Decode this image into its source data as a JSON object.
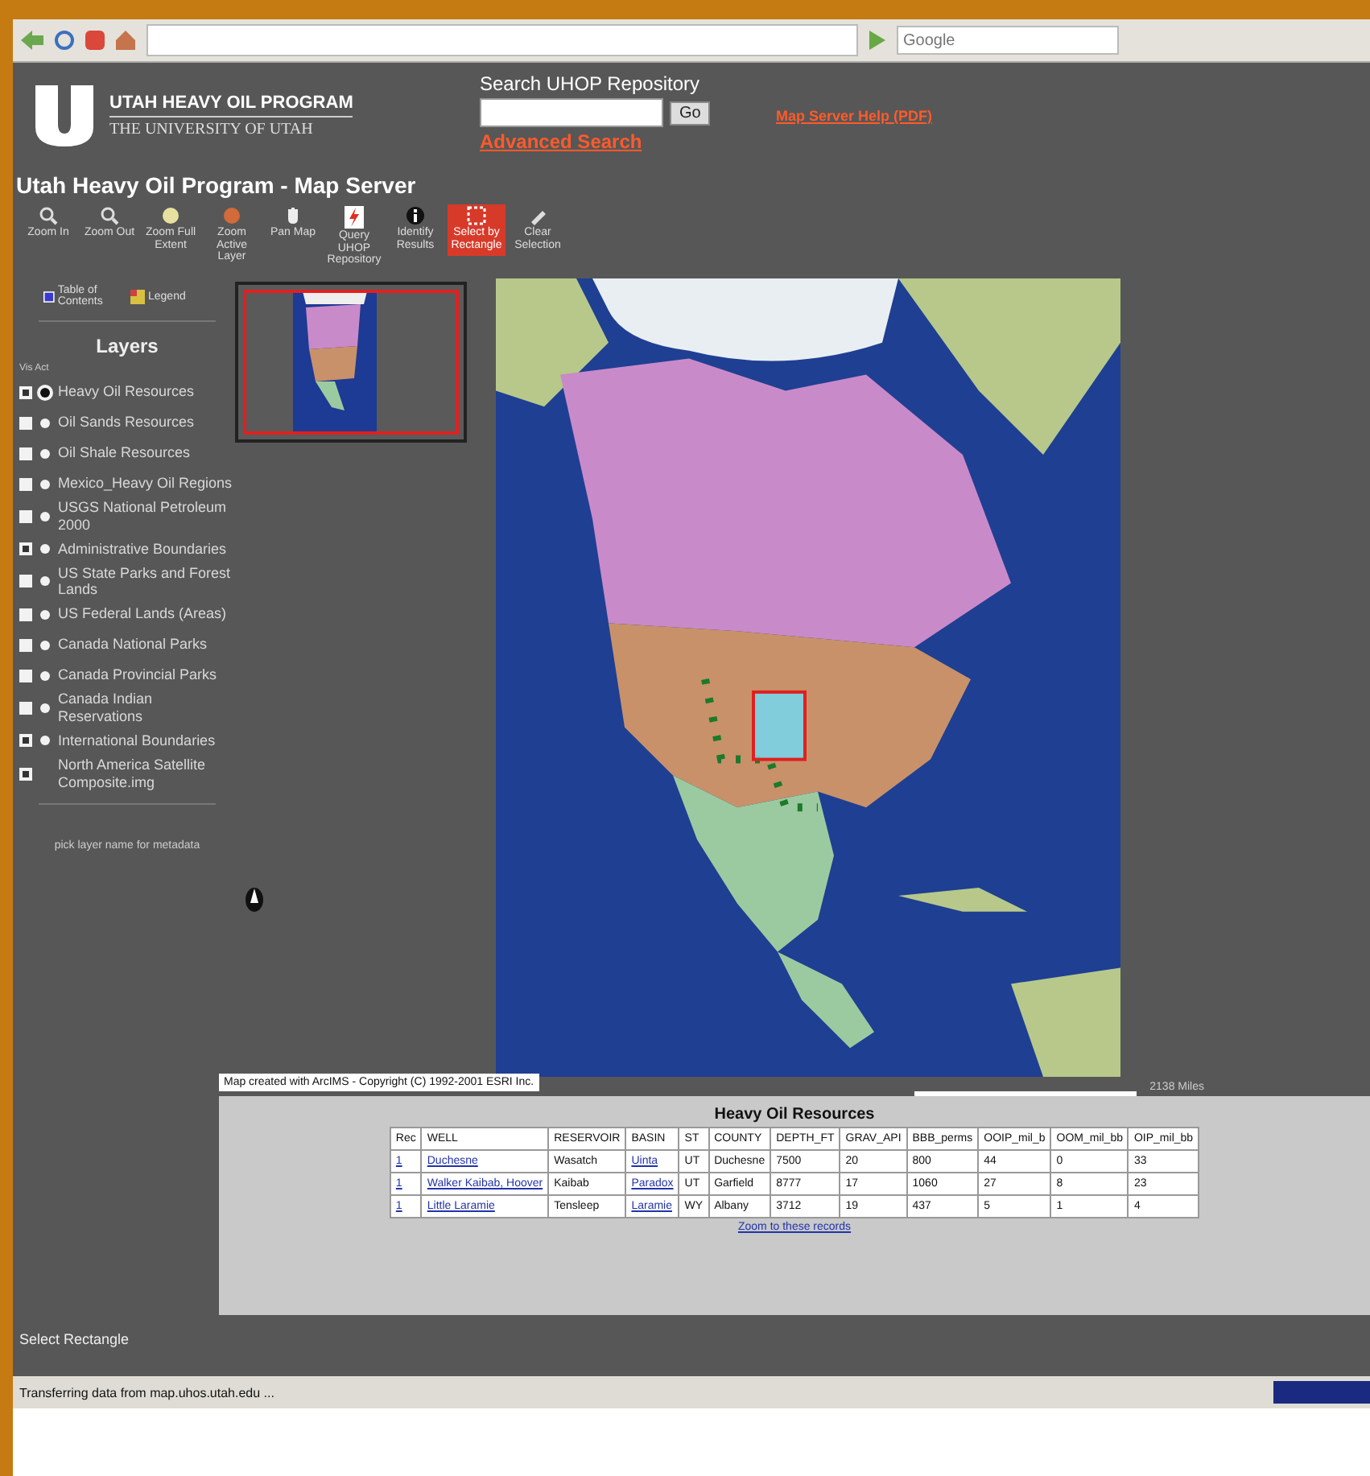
{
  "browser": {
    "search_placeholder": "Google"
  },
  "header": {
    "program": "UTAH HEAVY OIL PROGRAM",
    "university": "THE UNIVERSITY OF UTAH",
    "search_label": "Search UHOP Repository",
    "search_button": "Go",
    "advanced_link": "Advanced Search",
    "help_link": "Map Server Help (PDF)"
  },
  "title": "Utah Heavy Oil Program - Map Server",
  "tools": [
    {
      "kind": "zoom-in",
      "label": "Zoom In",
      "selected": false
    },
    {
      "kind": "zoom-out",
      "label": "Zoom Out",
      "selected": false
    },
    {
      "kind": "full-extent",
      "label": "Zoom Full Extent",
      "selected": false
    },
    {
      "kind": "active-layer",
      "label": "Zoom Active Layer",
      "selected": false
    },
    {
      "kind": "pan",
      "label": "Pan Map",
      "selected": false
    },
    {
      "kind": "query",
      "label": "Query UHOP Repository",
      "selected": false
    },
    {
      "kind": "identify",
      "label": "Identify Results",
      "selected": false
    },
    {
      "kind": "select",
      "label": "Select by Rectangle",
      "selected": true
    },
    {
      "kind": "clear",
      "label": "Clear Selection",
      "selected": false
    }
  ],
  "sidebar": {
    "toc": "Table of Contents",
    "legend": "Legend",
    "layers_title": "Layers",
    "columns": "Vis Act",
    "note": "pick layer name for metadata",
    "layers": [
      {
        "kind": "feature",
        "name": "Heavy Oil Resources",
        "visible": true,
        "active": true
      },
      {
        "kind": "feature",
        "name": "Oil Sands Resources",
        "visible": false,
        "active": false
      },
      {
        "kind": "feature",
        "name": "Oil Shale Resources",
        "visible": false,
        "active": false
      },
      {
        "kind": "feature",
        "name": "Mexico_Heavy Oil Regions",
        "visible": false,
        "active": false
      },
      {
        "kind": "feature",
        "name": "USGS National Petroleum 2000",
        "visible": false,
        "active": false
      },
      {
        "kind": "feature",
        "name": "Administrative Boundaries",
        "visible": true,
        "active": false
      },
      {
        "kind": "feature",
        "name": "US State Parks and Forest Lands",
        "visible": false,
        "active": false
      },
      {
        "kind": "feature",
        "name": "US Federal Lands (Areas)",
        "visible": false,
        "active": false
      },
      {
        "kind": "feature",
        "name": "Canada National Parks",
        "visible": false,
        "active": false
      },
      {
        "kind": "feature",
        "name": "Canada Provincial Parks",
        "visible": false,
        "active": false
      },
      {
        "kind": "feature",
        "name": "Canada Indian Reservations",
        "visible": false,
        "active": false
      },
      {
        "kind": "feature",
        "name": "International Boundaries",
        "visible": true,
        "active": false
      },
      {
        "name": "North America Satellite Composite.img",
        "visible": true
      }
    ]
  },
  "map": {
    "scale": "2138 Miles"
  },
  "results": {
    "copyright": "Map created with ArcIMS - Copyright (C) 1992-2001 ESRI Inc.",
    "title": "Heavy Oil Resources",
    "columns": [
      {
        "label": "Rec",
        "kind": "link"
      },
      {
        "label": "WELL",
        "kind": "link"
      },
      {
        "label": "RESERVOIR",
        "kind": "text"
      },
      {
        "label": "BASIN",
        "kind": "link"
      },
      {
        "label": "ST",
        "kind": "text"
      },
      {
        "label": "COUNTY",
        "kind": "text"
      },
      {
        "label": "DEPTH_FT",
        "kind": "text"
      },
      {
        "label": "GRAV_API",
        "kind": "text"
      },
      {
        "label": "BBB_perms",
        "kind": "text"
      },
      {
        "label": "OOIP_mil_b",
        "kind": "text"
      },
      {
        "label": "OOM_mil_bb",
        "kind": "text"
      },
      {
        "label": "OIP_mil_bb",
        "kind": "text"
      }
    ],
    "rows": [
      [
        "1",
        "Duchesne",
        "Wasatch",
        "Uinta",
        "UT",
        "Duchesne",
        "7500",
        "20",
        "800",
        "44",
        "0",
        "33"
      ],
      [
        "1",
        "Walker Kaibab, Hoover",
        "Kaibab",
        "Paradox",
        "UT",
        "Garfield",
        "8777",
        "17",
        "1060",
        "27",
        "8",
        "23"
      ],
      [
        "1",
        "Little Laramie",
        "Tensleep",
        "Laramie",
        "WY",
        "Albany",
        "3712",
        "19",
        "437",
        "5",
        "1",
        "4"
      ]
    ],
    "zoom_link": "Zoom to these records"
  },
  "status_text": "Select Rectangle",
  "status_bar": {
    "text": "Transferring data from map.uhos.utah.edu ...",
    "level": 1
  }
}
